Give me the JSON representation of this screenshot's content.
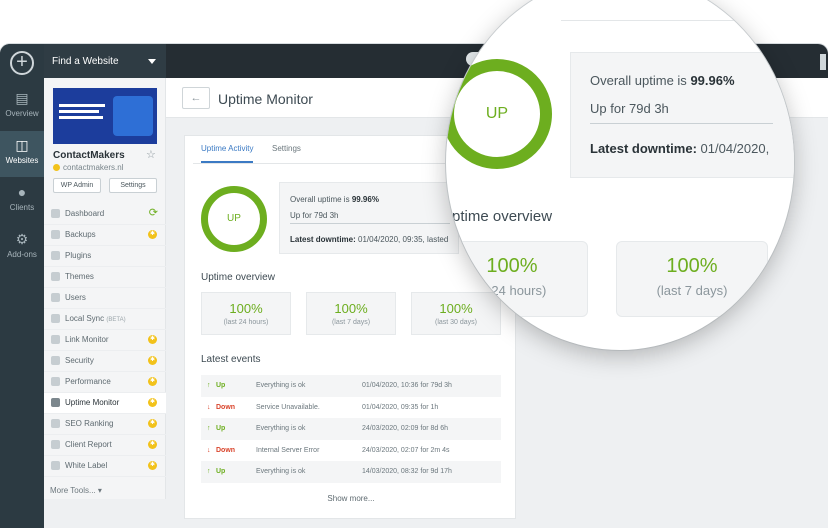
{
  "sidebar_rail": {
    "items": [
      {
        "label": "Overview",
        "icon": "chart-icon"
      },
      {
        "label": "Websites",
        "icon": "pages-icon"
      },
      {
        "label": "Clients",
        "icon": "clients-icon"
      },
      {
        "label": "Add-ons",
        "icon": "gear-icon"
      }
    ]
  },
  "site_panel": {
    "finder_label": "Find a Website",
    "site_name": "ContactMakers",
    "site_url": "contactmakers.nl",
    "wp_admin_label": "WP Admin",
    "settings_label": "Settings",
    "menu": [
      {
        "label": "Dashboard"
      },
      {
        "label": "Backups"
      },
      {
        "label": "Plugins"
      },
      {
        "label": "Themes"
      },
      {
        "label": "Users"
      },
      {
        "label": "Local Sync",
        "tag": "(BETA)"
      },
      {
        "label": "Link Monitor"
      },
      {
        "label": "Security"
      },
      {
        "label": "Performance"
      },
      {
        "label": "Uptime Monitor"
      },
      {
        "label": "SEO Ranking"
      },
      {
        "label": "Client Report"
      },
      {
        "label": "White Label"
      }
    ],
    "more_tools": "More Tools..."
  },
  "page": {
    "title": "Uptime Monitor",
    "tabs": [
      "Uptime Activity",
      "Settings"
    ],
    "status": "UP",
    "overall_label": "Overall uptime is",
    "overall_value": "99.96%",
    "up_for": "Up for 79d 3h",
    "last_downtime_label": "Latest downtime:",
    "last_downtime_value": "01/04/2020, 09:35, lasted",
    "overview_title": "Uptime overview",
    "overview": [
      {
        "value": "100%",
        "period": "(last 24 hours)"
      },
      {
        "value": "100%",
        "period": "(last 7 days)"
      },
      {
        "value": "100%",
        "period": "(last 30 days)"
      }
    ],
    "events_title": "Latest events",
    "events": [
      {
        "status": "Up",
        "message": "Everything is ok",
        "when": "01/04/2020, 10:36 for 79d 3h"
      },
      {
        "status": "Down",
        "message": "Service Unavailable.",
        "when": "01/04/2020, 09:35 for 1h"
      },
      {
        "status": "Up",
        "message": "Everything is ok",
        "when": "24/03/2020, 02:09 for 8d 6h"
      },
      {
        "status": "Down",
        "message": "Internal Server Error",
        "when": "24/03/2020, 02:07 for 2m 4s"
      },
      {
        "status": "Up",
        "message": "Everything is ok",
        "when": "14/03/2020, 08:32 for 9d 17h"
      }
    ],
    "show_more": "Show more..."
  },
  "magnifier": {
    "status": "UP",
    "overall_label": "Overall uptime is",
    "overall_value": "99.96%",
    "up_for": "Up for 79d 3h",
    "last_downtime_label": "Latest downtime:",
    "last_downtime_value": "01/04/2020,",
    "overview_title": "ptime overview",
    "tile1_value": "100%",
    "tile1_period": "st 24 hours)",
    "tile2_value": "100%",
    "tile2_period": "(last 7 days)"
  },
  "colors": {
    "accent_green": "#6dae1f",
    "down_red": "#d9442b",
    "tab_blue": "#3b7ac4",
    "badge_yellow": "#f2c21a"
  }
}
